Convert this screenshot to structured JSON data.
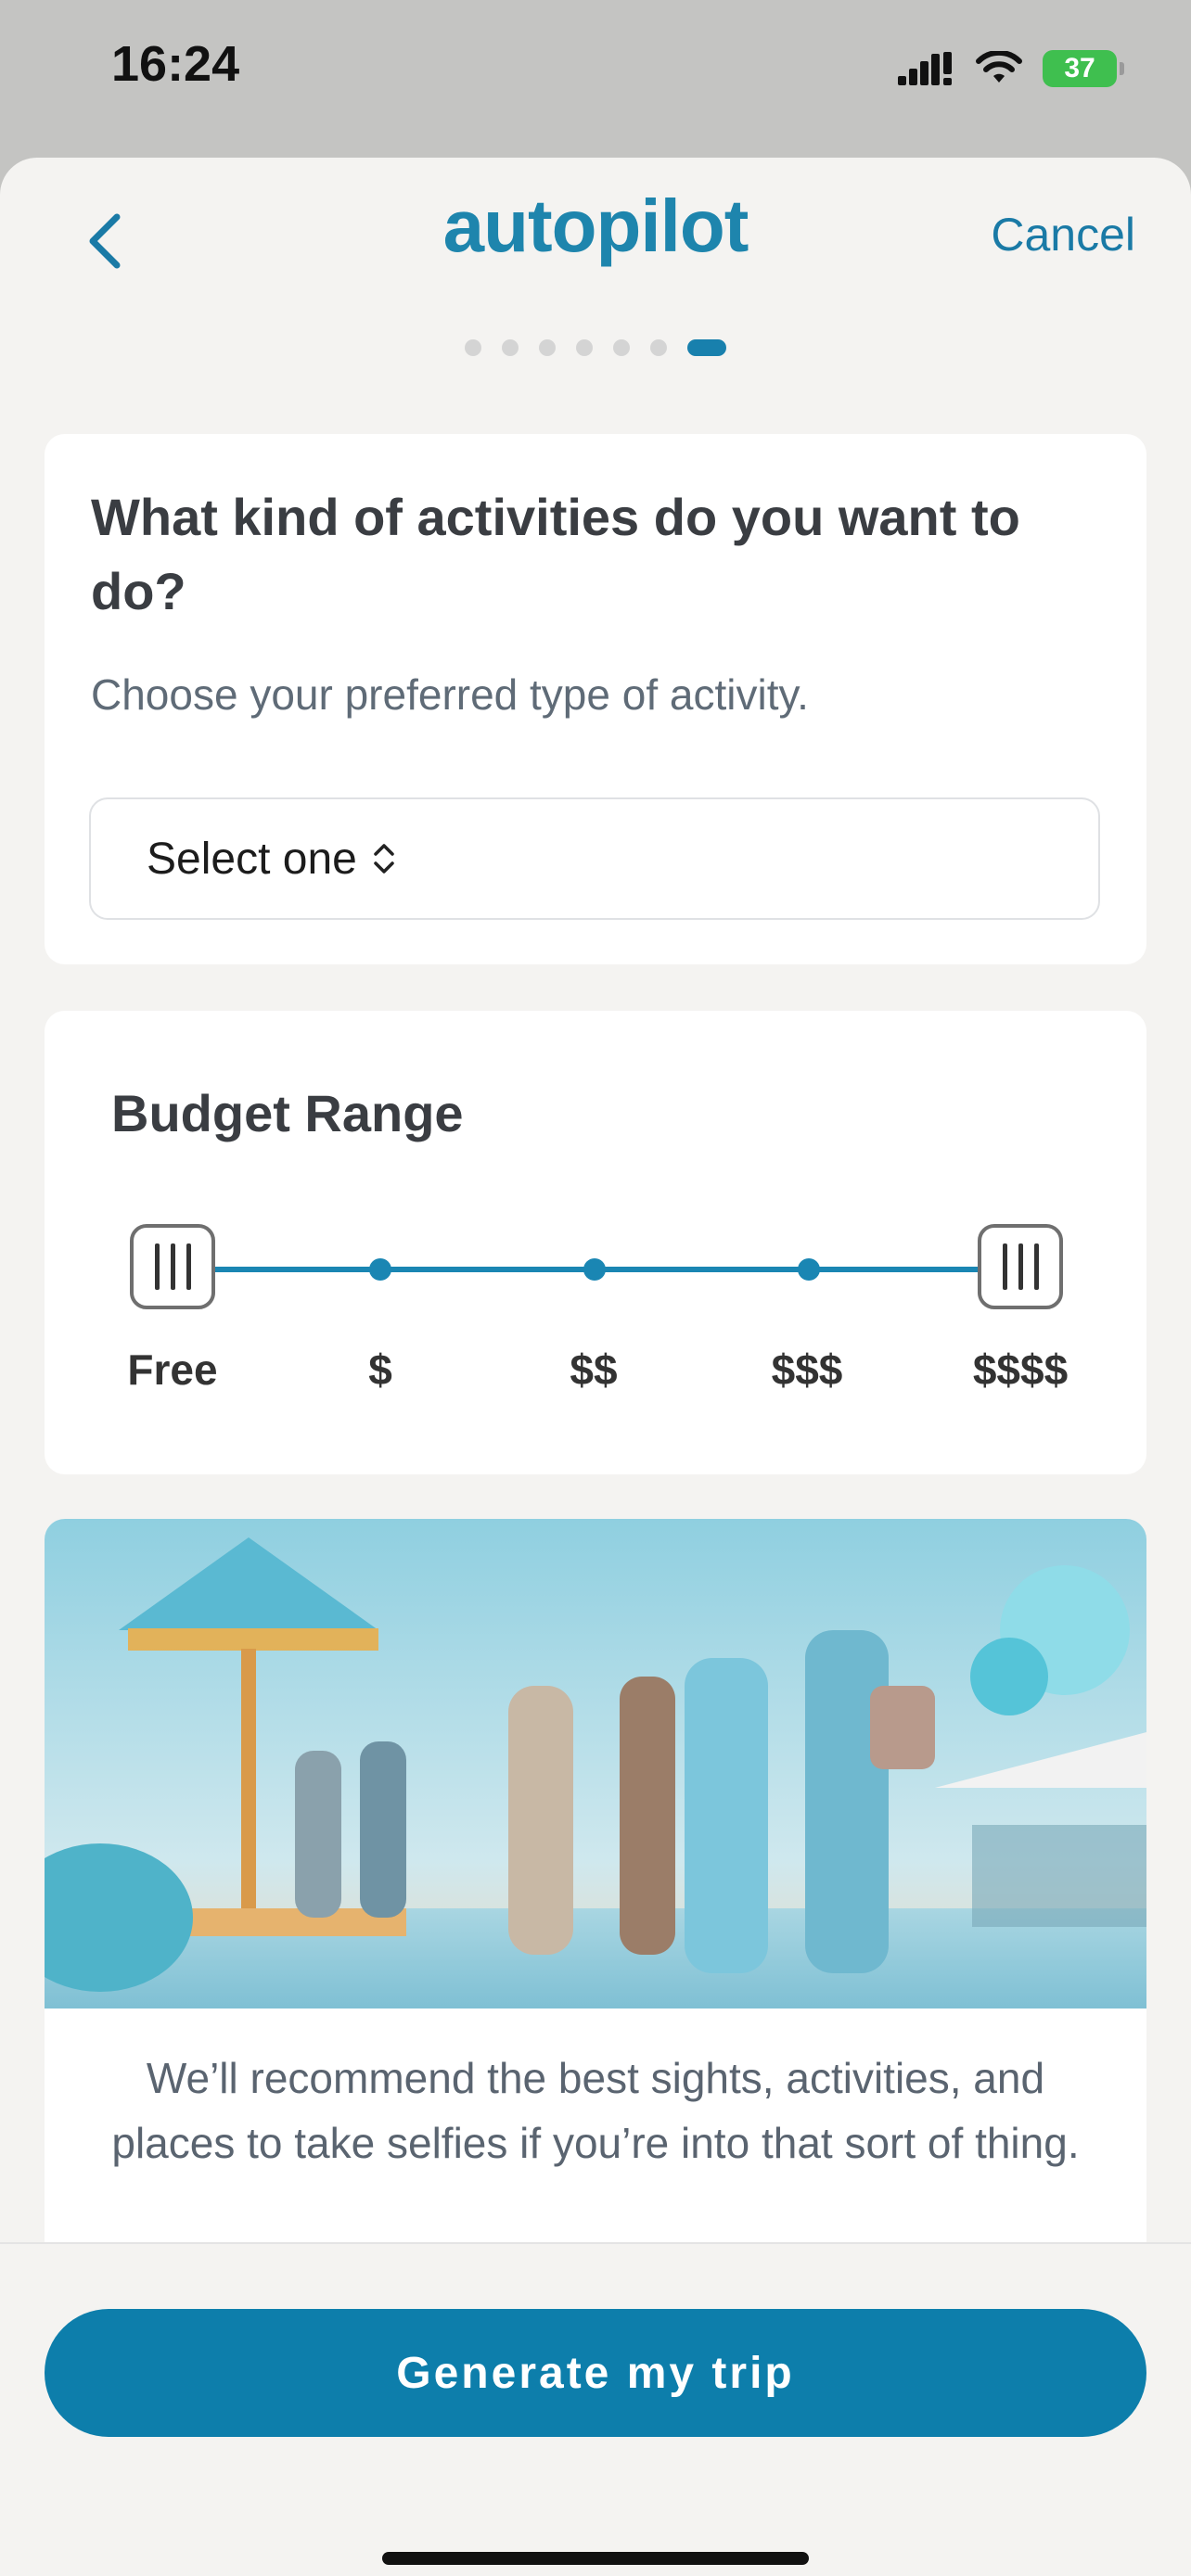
{
  "status_bar": {
    "time": "16:24",
    "battery": "37",
    "icons": [
      "signal-icon",
      "wifi-icon",
      "battery-icon"
    ]
  },
  "header": {
    "logo": "autopilot",
    "cancel_label": "Cancel",
    "back_icon": "chevron-left-icon"
  },
  "progress": {
    "total_steps": 7,
    "current_step": 7
  },
  "activity": {
    "title": "What kind of activities do you want to do?",
    "subtitle": "Choose your preferred type of activity.",
    "select_value": "Select one"
  },
  "budget": {
    "title": "Budget Range",
    "labels": [
      "Free",
      "$",
      "$$",
      "$$$",
      "$$$$"
    ],
    "range_min": "Free",
    "range_max": "$$$$"
  },
  "image_card": {
    "description": "We’ll recommend the best sights, activities, and places to take selfies if you’re into that sort of thing."
  },
  "footer": {
    "generate_label": "Generate my trip"
  },
  "colors": {
    "brand": "#1e85ad",
    "button": "#0d7eab",
    "background": "#f4f3f1"
  }
}
